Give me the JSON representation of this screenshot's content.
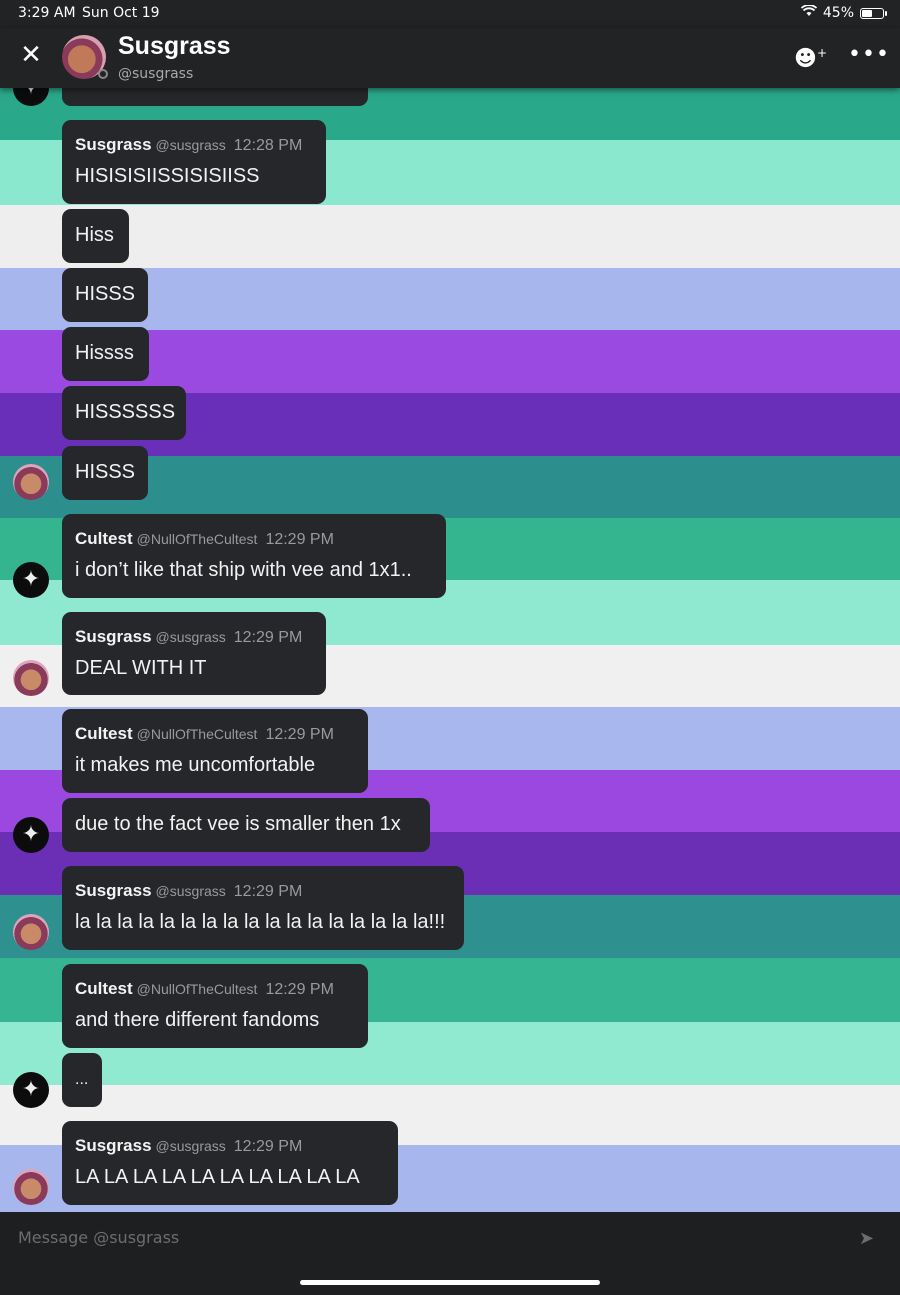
{
  "status_bar": {
    "time": "3:29 AM",
    "date": "Sun Oct 19",
    "battery": "45%",
    "battery_level": 0.45
  },
  "header": {
    "name": "Susgrass",
    "handle": "@susgrass"
  },
  "messages": [
    {
      "kind": "full",
      "user": "Susgrass",
      "handle": "@susgrass",
      "time": "12:28 PM",
      "text": "HISISISIISSISISIISS"
    },
    {
      "kind": "simple",
      "text": "Hiss"
    },
    {
      "kind": "simple",
      "text": "HISSS"
    },
    {
      "kind": "simple",
      "text": "Hissss"
    },
    {
      "kind": "simple",
      "text": "HISSSSSS"
    },
    {
      "kind": "simple",
      "text": "HISSS"
    },
    {
      "kind": "full",
      "user": "Cultest",
      "handle": "@NullOfTheCultest",
      "time": "12:29 PM",
      "text": "i don’t like that ship with vee and 1x1.."
    },
    {
      "kind": "full",
      "user": "Susgrass",
      "handle": "@susgrass",
      "time": "12:29 PM",
      "text": "DEAL WITH IT"
    },
    {
      "kind": "full",
      "user": "Cultest",
      "handle": "@NullOfTheCultest",
      "time": "12:29 PM",
      "text": "it makes me uncomfortable"
    },
    {
      "kind": "simple",
      "text": "due to the fact vee is smaller then 1x"
    },
    {
      "kind": "full",
      "user": "Susgrass",
      "handle": "@susgrass",
      "time": "12:29 PM",
      "text": "la la la la la la la la la la la la la la la la la!!!"
    },
    {
      "kind": "full",
      "user": "Cultest",
      "handle": "@NullOfTheCultest",
      "time": "12:29 PM",
      "text": "and there different fandoms"
    },
    {
      "kind": "simple",
      "text": "..."
    },
    {
      "kind": "full",
      "user": "Susgrass",
      "handle": "@susgrass",
      "time": "12:29 PM",
      "text": "LA LA LA LA LA LA LA LA LA LA"
    }
  ],
  "composer": {
    "placeholder": "Message @susgrass"
  },
  "icons": {
    "close": "close-icon",
    "add_friend": "add-friend-icon",
    "more": "more-icon",
    "send": "send-icon"
  }
}
